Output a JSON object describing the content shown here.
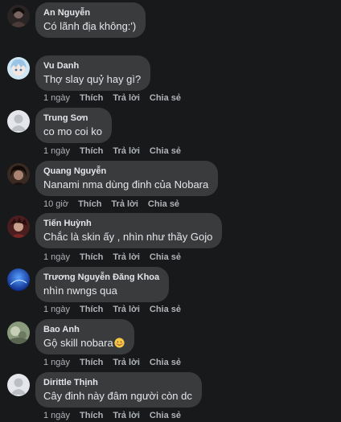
{
  "comments": [
    {
      "name": "An Nguyễn",
      "text": "Có lãnh địa không:')",
      "time": "",
      "like": "",
      "reply": "",
      "share": "",
      "avatar": "dark-portrait"
    },
    {
      "name": "Vu Danh",
      "text": "Thợ slay quỷ hay gì?",
      "time": "1 ngày",
      "like": "Thích",
      "reply": "Trả lời",
      "share": "Chia sẻ",
      "avatar": "anime-blue"
    },
    {
      "name": "Trung Sơn",
      "text": "co mo coi ko",
      "time": "1 ngày",
      "like": "Thích",
      "reply": "Trả lời",
      "share": "Chia sẻ",
      "avatar": "default-user"
    },
    {
      "name": "Quang Nguyễn",
      "text": "Nanami nma dùng đinh của Nobara",
      "time": "10 giờ",
      "like": "Thích",
      "reply": "Trả lời",
      "share": "Chia sẻ",
      "avatar": "dark-hair"
    },
    {
      "name": "Tiến Huỳnh",
      "text": "Chắc là skin ấy , nhìn như thầy Gojo",
      "time": "",
      "like": "",
      "reply": "",
      "share": "",
      "avatar": "red-dark"
    },
    {
      "name": "Trương Nguyễn Đăng Khoa",
      "text": "nhìn nwngs qua",
      "time": "1 ngày",
      "like": "Thích",
      "reply": "Trả lời",
      "share": "Chia sẻ",
      "avatar": "blue-sky"
    },
    {
      "name": "Bao Anh",
      "text": "Gộ skill nobara",
      "time": "1 ngày",
      "like": "Thích",
      "reply": "Trả lời",
      "share": "Chia sẻ",
      "avatar": "green-grey"
    },
    {
      "name": "Dirittle Thịnh",
      "text": "Cây đinh này đâm người còn dc",
      "time": "1 ngày",
      "like": "Thích",
      "reply": "Trả lời",
      "share": "Chia sẻ",
      "avatar": "default-user"
    }
  ],
  "extra_actions": [
    {
      "time": "1 ngày",
      "like": "Thích",
      "reply": "Trả lời",
      "share": "Chia sẻ"
    },
    {
      "time": "1 ngày",
      "like": "Thích",
      "reply": "Trả lời",
      "share": "Chia sẻ"
    }
  ],
  "colors": {
    "background": "#18191a",
    "bubble": "#3a3b3c",
    "text": "#e4e6eb",
    "secondary": "#b0b3b8"
  }
}
